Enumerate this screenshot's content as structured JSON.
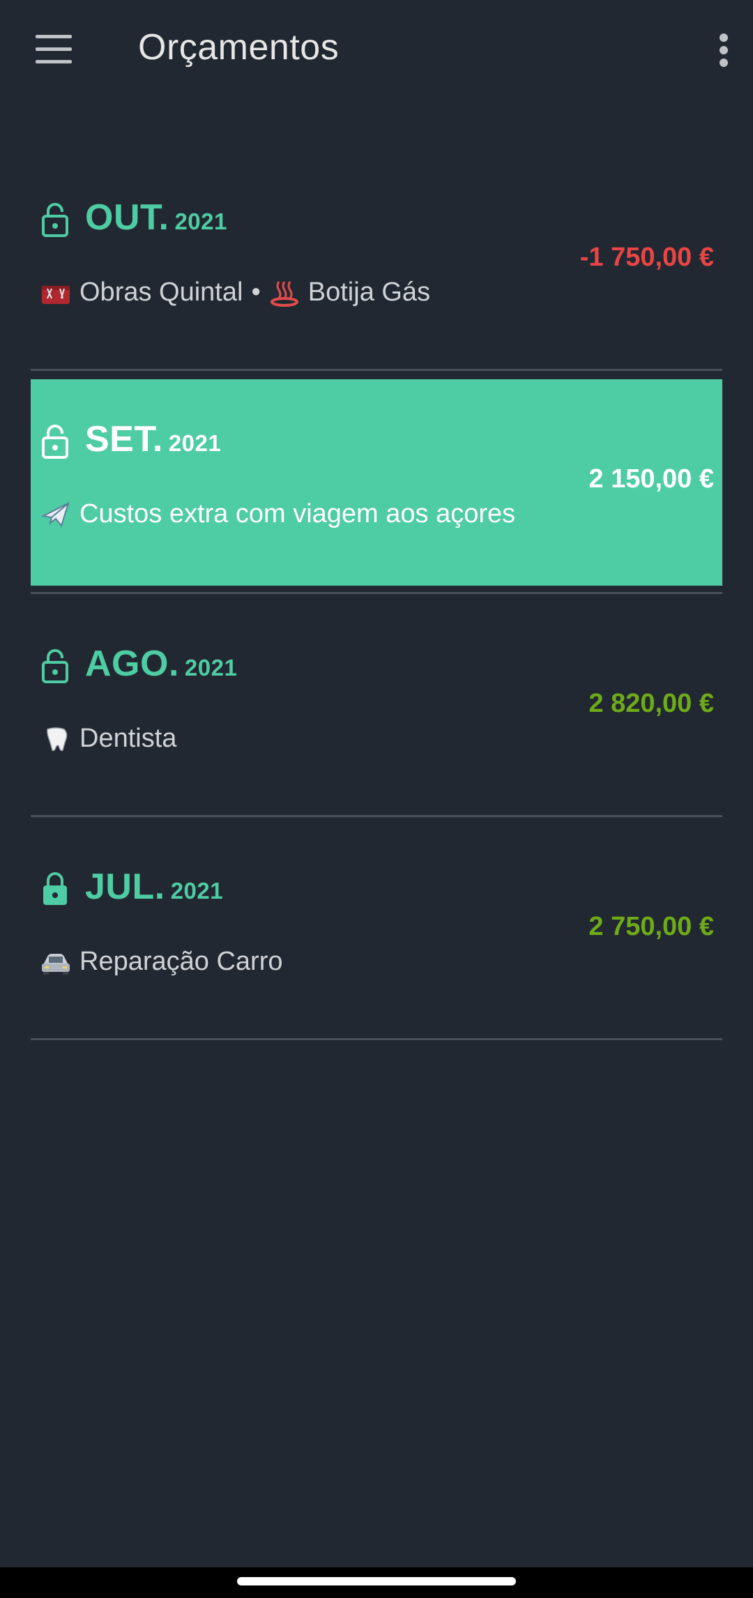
{
  "app_bar": {
    "title": "Orçamentos",
    "menu_icon": "hamburger-menu-icon",
    "more_icon": "more-vertical-icon"
  },
  "colors": {
    "background": "#222831",
    "accent": "#4ecca3",
    "negative": "#e84545",
    "positive": "#6eab19",
    "divider": "#4a5058"
  },
  "budgets": [
    {
      "month": "OUT.",
      "year": "2021",
      "lock": "lock-open-icon",
      "items": [
        {
          "emoji": "toolbox-icon",
          "label": "Obras Quintal"
        },
        {
          "emoji": "hot-springs-icon",
          "label": "Botija Gás"
        }
      ],
      "separator": "•",
      "amount": "-1 750,00 €",
      "amount_status": "negative",
      "selected": false
    },
    {
      "month": "SET.",
      "year": "2021",
      "lock": "lock-open-icon",
      "items": [
        {
          "emoji": "airplane-icon",
          "label": "Custos extra com viagem aos açores"
        }
      ],
      "amount": "2 150,00 €",
      "amount_status": "positive",
      "selected": true
    },
    {
      "month": "AGO.",
      "year": "2021",
      "lock": "lock-open-icon",
      "items": [
        {
          "emoji": "tooth-icon",
          "label": "Dentista"
        }
      ],
      "amount": "2 820,00 €",
      "amount_status": "positive",
      "selected": false
    },
    {
      "month": "JUL.",
      "year": "2021",
      "lock": "lock-closed-icon",
      "items": [
        {
          "emoji": "car-icon",
          "label": "Reparação Carro"
        }
      ],
      "amount": "2 750,00 €",
      "amount_status": "positive",
      "selected": false
    }
  ]
}
